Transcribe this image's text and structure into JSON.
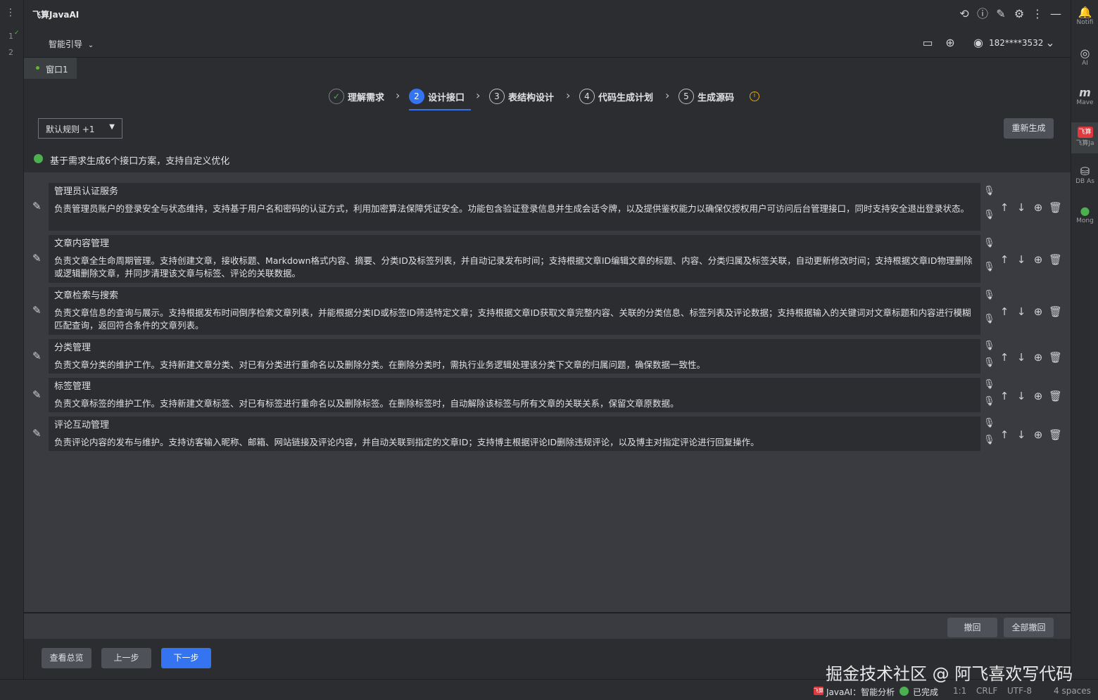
{
  "left_gutter": {
    "menu_icon": "⋮",
    "line_numbers": [
      "1",
      "2"
    ]
  },
  "header": {
    "app_title": "飞算JavaAI",
    "icons": [
      "history-icon",
      "help-icon",
      "edit-icon",
      "settings-icon",
      "more-icon",
      "minimize-icon"
    ],
    "smart_guide_label": "智能引导",
    "user_phone": "182****3532"
  },
  "tabs": [
    {
      "label": "窗口1"
    }
  ],
  "stepper": {
    "steps": [
      {
        "num": "✓",
        "label": "理解需求",
        "state": "done"
      },
      {
        "num": "2",
        "label": "设计接口",
        "state": "active"
      },
      {
        "num": "3",
        "label": "表结构设计",
        "state": "todo"
      },
      {
        "num": "4",
        "label": "代码生成计划",
        "state": "todo"
      },
      {
        "num": "5",
        "label": "生成源码",
        "state": "todo"
      }
    ]
  },
  "toolbar": {
    "rule_select_value": "默认规则 +1",
    "regenerate_label": "重新生成"
  },
  "status_message": "基于需求生成6个接口方案，支持自定义优化",
  "interfaces": [
    {
      "title": "管理员认证服务",
      "desc": "负责管理员账户的登录安全与状态维持，支持基于用户名和密码的认证方式，利用加密算法保障凭证安全。功能包含验证登录信息并生成会话令牌，以及提供鉴权能力以确保仅授权用户可访问后台管理接口，同时支持安全退出登录状态。"
    },
    {
      "title": "文章内容管理",
      "desc": "负责文章全生命周期管理。支持创建文章，接收标题、Markdown格式内容、摘要、分类ID及标签列表，并自动记录发布时间；支持根据文章ID编辑文章的标题、内容、分类归属及标签关联，自动更新修改时间；支持根据文章ID物理删除或逻辑删除文章，并同步清理该文章与标签、评论的关联数据。"
    },
    {
      "title": "文章检索与搜索",
      "desc": "负责文章信息的查询与展示。支持根据发布时间倒序检索文章列表，并能根据分类ID或标签ID筛选特定文章；支持根据文章ID获取文章完整内容、关联的分类信息、标签列表及评论数据；支持根据输入的关键词对文章标题和内容进行模糊匹配查询，返回符合条件的文章列表。"
    },
    {
      "title": "分类管理",
      "desc": "负责文章分类的维护工作。支持新建文章分类、对已有分类进行重命名以及删除分类。在删除分类时，需执行业务逻辑处理该分类下文章的归属问题，确保数据一致性。"
    },
    {
      "title": "标签管理",
      "desc": "负责文章标签的维护工作。支持新建文章标签、对已有标签进行重命名以及删除标签。在删除标签时，自动解除该标签与所有文章的关联关系，保留文章原数据。"
    },
    {
      "title": "评论互动管理",
      "desc": "负责评论内容的发布与维护。支持访客输入昵称、邮箱、网站链接及评论内容，并自动关联到指定的文章ID；支持博主根据评论ID删除违规评论，以及博主对指定评论进行回复操作。"
    }
  ],
  "undo_bar": {
    "undo_label": "撤回",
    "undo_all_label": "全部撤回"
  },
  "nav": {
    "overview_label": "查看总览",
    "prev_label": "上一步",
    "next_label": "下一步"
  },
  "right_tools": [
    {
      "label": "Notifi",
      "icon": "bell-icon"
    },
    {
      "label": "AI",
      "icon": "ai-icon"
    },
    {
      "label": "Mave",
      "icon": "maven-icon"
    },
    {
      "label": "飞算Ja",
      "icon": "feisuan-icon"
    },
    {
      "label": "DB As",
      "icon": "db-icon"
    },
    {
      "label": "Mong",
      "icon": "mongo-icon"
    }
  ],
  "status_bar": {
    "brand_text": "飞算",
    "javaai_status": "JavaAI：智能分析",
    "done_text": "已完成",
    "position": "1:1",
    "line_sep": "CRLF",
    "encoding": "UTF-8",
    "indent": "4 spaces"
  },
  "watermark": "掘金技术社区 @ 阿飞喜欢写代码",
  "colors": {
    "accent": "#3574f0",
    "success": "#4caf50",
    "warning": "#e5a50a"
  }
}
